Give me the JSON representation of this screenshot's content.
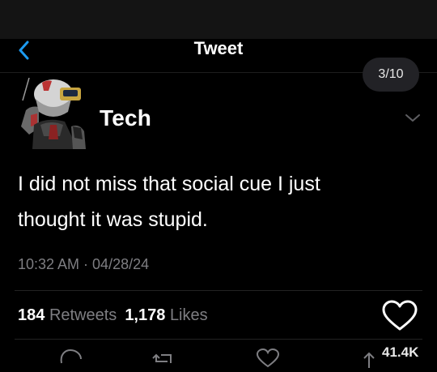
{
  "nav": {
    "title": "Tweet"
  },
  "thread_counter": "3/10",
  "tweet": {
    "author_name": "Tech",
    "text_line1": "I did not miss that social cue I just",
    "text_line2": "thought it was stupid.",
    "timestamp": "10:32 AM · 04/28/24"
  },
  "stats": {
    "retweets_count": "184",
    "retweets_label": "Retweets",
    "likes_count": "1,178",
    "likes_label": "Likes"
  },
  "actions": {
    "views_count": "41.4K"
  },
  "colors": {
    "background": "#000000",
    "accent_blue": "#1d9bf0",
    "secondary_text": "#7e7e82"
  },
  "icons": [
    "back-chevron-icon",
    "chevron-down-icon",
    "heart-icon",
    "reply-icon",
    "retweet-icon",
    "share-arrow-icon"
  ]
}
